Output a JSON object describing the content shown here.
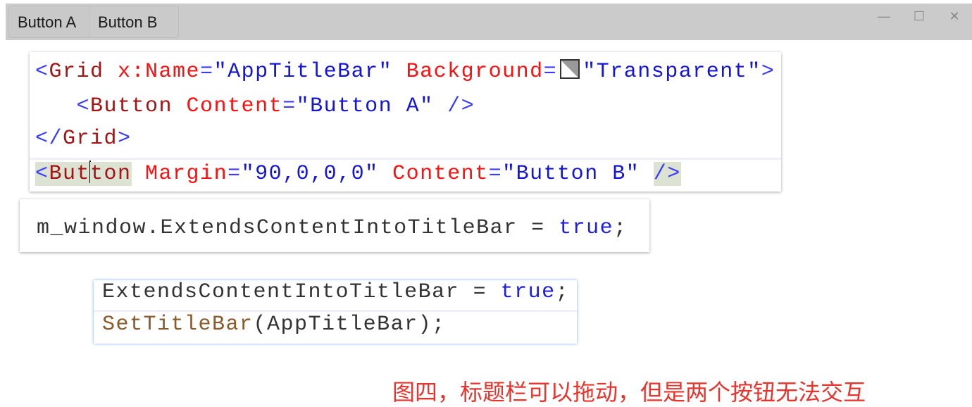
{
  "titlebar": {
    "button_a": "Button A",
    "button_b": "Button B",
    "minimize": "—",
    "maximize": "☐",
    "close": "✕"
  },
  "panel1": {
    "lines": [
      [
        {
          "t": "<",
          "c": "br"
        },
        {
          "t": "Grid",
          "c": "el"
        },
        {
          "t": " x:Name",
          "c": "at"
        },
        {
          "t": "=",
          "c": "br"
        },
        {
          "t": "\"AppTitleBar\"",
          "c": "va"
        },
        {
          "t": " Background",
          "c": "at"
        },
        {
          "t": "=",
          "c": "br"
        },
        {
          "t": "",
          "c": "swatch"
        },
        {
          "t": "\"Transparent\"",
          "c": "va"
        },
        {
          "t": ">",
          "c": "br"
        }
      ],
      [
        {
          "t": "   <",
          "c": "br"
        },
        {
          "t": "Button",
          "c": "el"
        },
        {
          "t": " Content",
          "c": "at"
        },
        {
          "t": "=",
          "c": "br"
        },
        {
          "t": "\"Button A\"",
          "c": "va"
        },
        {
          "t": " />",
          "c": "br"
        }
      ],
      [
        {
          "t": "</",
          "c": "br"
        },
        {
          "t": "Grid",
          "c": "el"
        },
        {
          "t": ">",
          "c": "br"
        }
      ],
      [
        {
          "t": "<",
          "c": "br hl"
        },
        {
          "t": "But",
          "c": "el hl"
        },
        {
          "t": "",
          "c": "caret"
        },
        {
          "t": "ton",
          "c": "el hl"
        },
        {
          "t": " Margin",
          "c": "at"
        },
        {
          "t": "=",
          "c": "br"
        },
        {
          "t": "\"90,0,0,0\"",
          "c": "va"
        },
        {
          "t": " Content",
          "c": "at"
        },
        {
          "t": "=",
          "c": "br"
        },
        {
          "t": "\"Button B\"",
          "c": "va"
        },
        {
          "t": " ",
          "c": "pl"
        },
        {
          "t": "/>",
          "c": "br hl"
        }
      ]
    ]
  },
  "panel2": {
    "lines": [
      [
        {
          "t": "m_window.ExtendsContentIntoTitleBar = ",
          "c": "pl"
        },
        {
          "t": "true",
          "c": "kw"
        },
        {
          "t": ";",
          "c": "pl"
        }
      ]
    ]
  },
  "panel3": {
    "lines": [
      [
        {
          "t": "ExtendsContentIntoTitleBar = ",
          "c": "pl"
        },
        {
          "t": "true",
          "c": "kw"
        },
        {
          "t": ";",
          "c": "pl"
        }
      ],
      [
        {
          "t": "SetTitleBar",
          "c": "fn"
        },
        {
          "t": "(AppTitleBar);",
          "c": "pl"
        }
      ]
    ]
  },
  "caption": "图四，标题栏可以拖动，但是两个按钮无法交互",
  "colors": {
    "caption": "#e8342c",
    "titlebar": "#cbcbcb",
    "attribute": "#ff1010",
    "value": "#1515d8",
    "element": "#a31515"
  }
}
